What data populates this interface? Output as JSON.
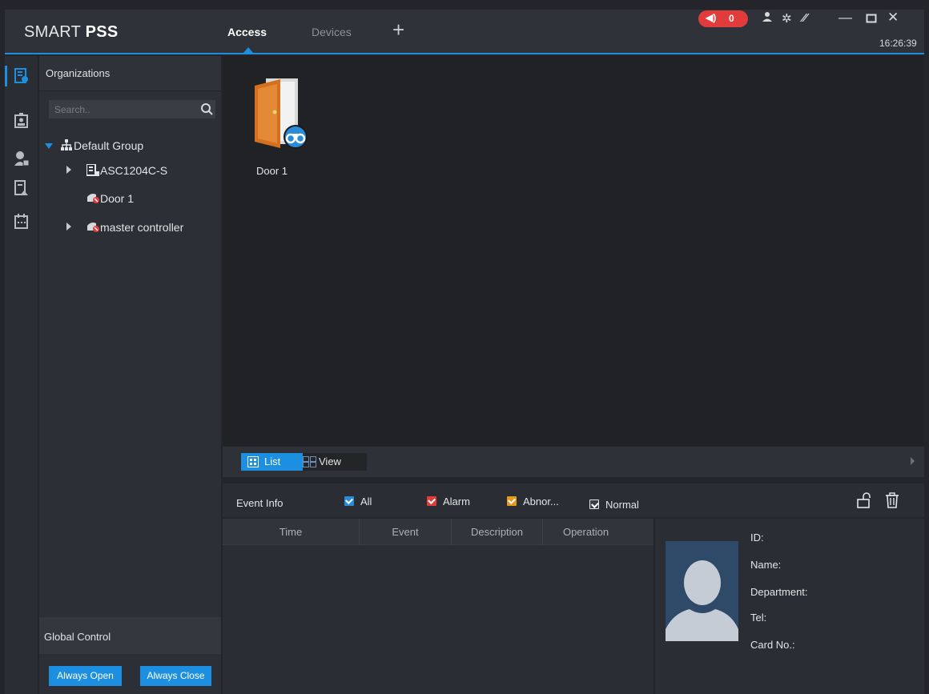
{
  "app": {
    "logo_prefix": "SMART ",
    "logo_bold": "PSS",
    "clock": "16:26:39",
    "alarm_count": "0",
    "accent_color": "#1d8fe0",
    "alarm_color": "#e23b3b"
  },
  "tabs": [
    {
      "label": "Access",
      "active": true
    },
    {
      "label": "Devices",
      "active": false
    }
  ],
  "add_tab_icon": "plus-icon",
  "window_controls": [
    "minimize-icon",
    "maximize-icon",
    "close-icon"
  ],
  "top_icons": [
    "speaker-icon",
    "user-icon",
    "gear-icon",
    "performance-gauge-icon"
  ],
  "nav_rail": [
    "door-monitor-icon",
    "personnel-card-icon",
    "user-permission-icon",
    "access-level-icon",
    "schedule-calendar-icon"
  ],
  "org": {
    "title": "Organizations",
    "search_placeholder": "Search..",
    "tree": [
      {
        "label": "Default Group",
        "level": 0,
        "expanded": true,
        "icon": "org-tree-icon"
      },
      {
        "label": "ASC1204C-S",
        "level": 1,
        "expanded": false,
        "icon": "controller-device-icon"
      },
      {
        "label": "Door 1",
        "level": 1,
        "expanded": null,
        "icon": "door-offline-icon"
      },
      {
        "label": "master controller",
        "level": 1,
        "expanded": false,
        "icon": "door-offline-icon"
      }
    ]
  },
  "global_control": {
    "title": "Global Control",
    "always_open": "Always Open",
    "always_close": "Always Close"
  },
  "doors": [
    {
      "label": "Door 1",
      "icon": "door-with-binoculars-icon"
    }
  ],
  "view_toggle": {
    "list": "List",
    "view": "View",
    "active": "List"
  },
  "event_filters": {
    "label": "Event Info",
    "items": [
      {
        "label": "All",
        "checked": true,
        "color": "#2a8bd6"
      },
      {
        "label": "Alarm",
        "checked": true,
        "color": "#e23b3b"
      },
      {
        "label": "Abnor...",
        "checked": true,
        "color": "#e59a1c"
      },
      {
        "label": "Normal",
        "checked": true,
        "color": "#3a3d44"
      }
    ]
  },
  "event_table": {
    "columns": [
      "Time",
      "Event",
      "Description",
      "Operation"
    ],
    "rows": []
  },
  "person_info": {
    "id": "ID:",
    "name": "Name:",
    "department": "Department:",
    "tel": "Tel:",
    "card_no": "Card No.:"
  }
}
